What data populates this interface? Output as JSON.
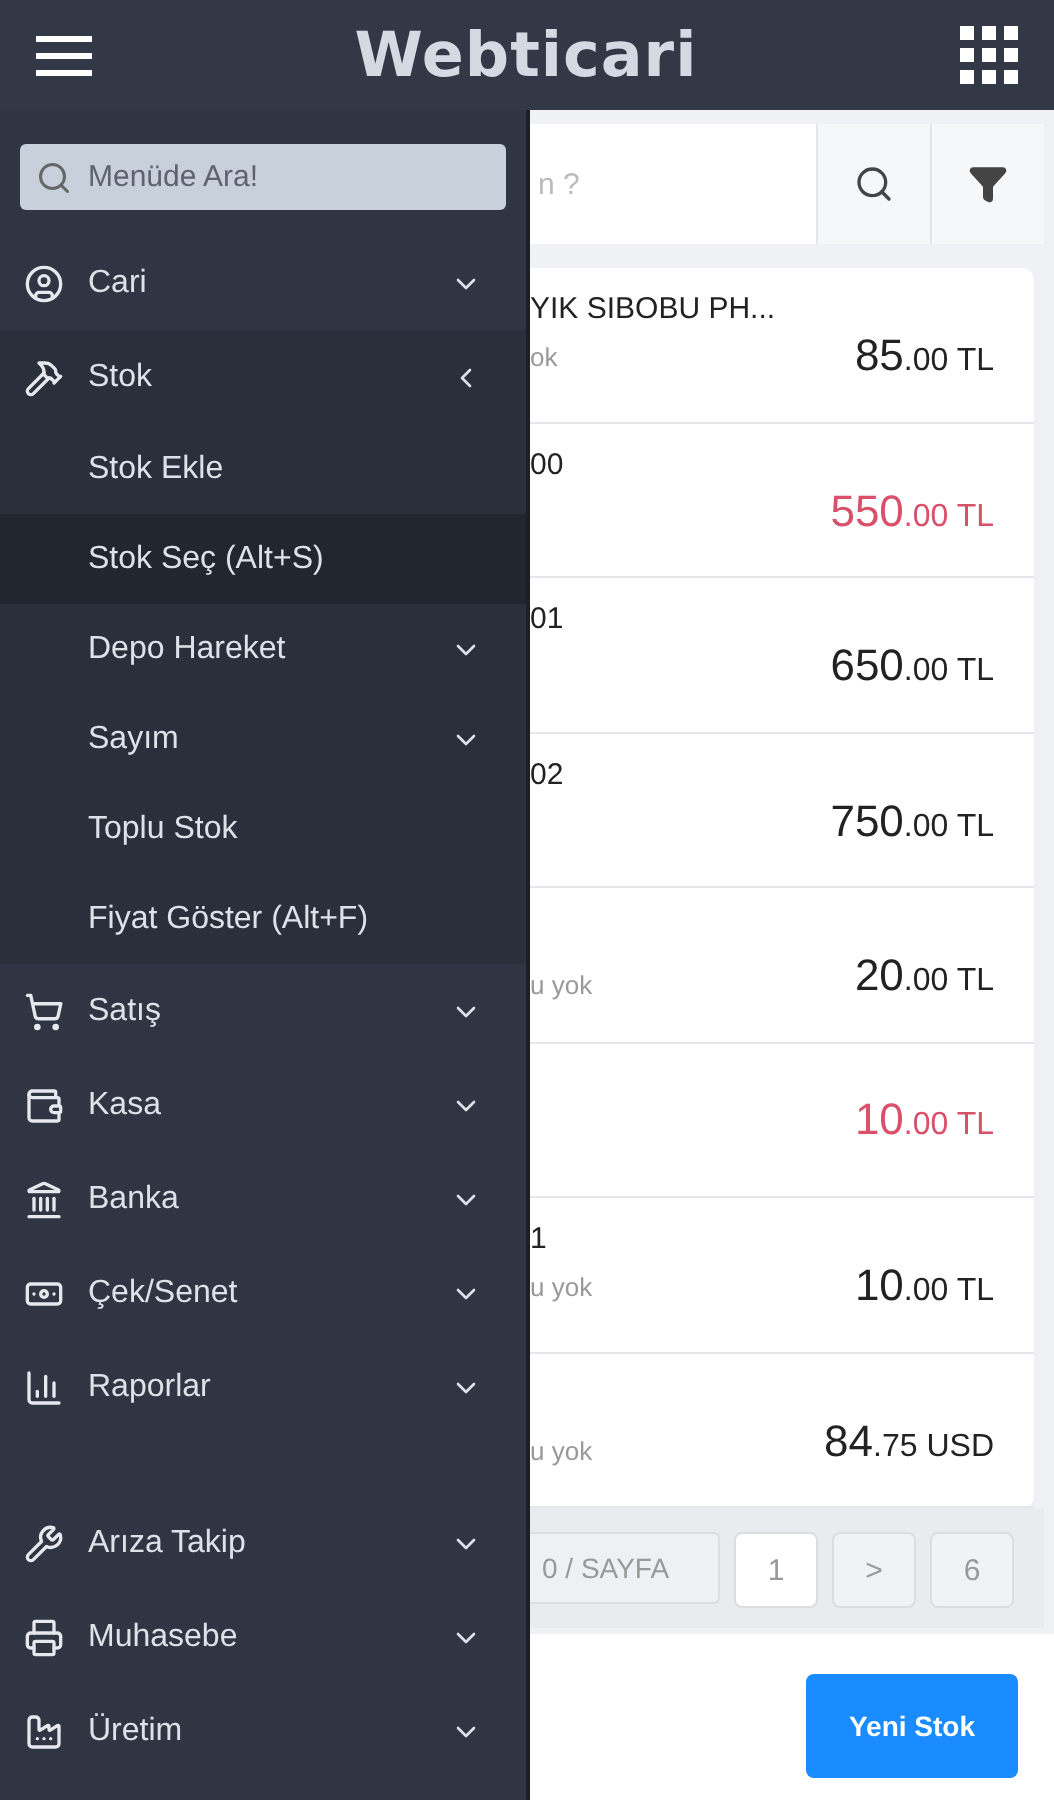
{
  "header": {
    "logo": "Webticari"
  },
  "sidebar": {
    "search": {
      "placeholder": "Menüde Ara!"
    },
    "items": [
      {
        "label": "Cari",
        "expanded": false
      },
      {
        "label": "Stok",
        "expanded": true,
        "children": [
          {
            "label": "Stok Ekle",
            "selected": false,
            "kind": "link"
          },
          {
            "label": "Stok Seç (Alt+S)",
            "selected": true,
            "kind": "link"
          },
          {
            "label": "Depo Hareket",
            "selected": false,
            "kind": "group"
          },
          {
            "label": "Sayım",
            "selected": false,
            "kind": "group"
          },
          {
            "label": "Toplu Stok",
            "selected": false,
            "kind": "link"
          },
          {
            "label": "Fiyat Göster (Alt+F)",
            "selected": false,
            "kind": "link"
          }
        ]
      },
      {
        "label": "Satış",
        "expanded": false
      },
      {
        "label": "Kasa",
        "expanded": false
      },
      {
        "label": "Banka",
        "expanded": false
      },
      {
        "label": "Çek/Senet",
        "expanded": false
      },
      {
        "label": "Raporlar",
        "expanded": false
      },
      {
        "label": "Arıza Takip",
        "expanded": false,
        "gap_before": true
      },
      {
        "label": "Muhasebe",
        "expanded": false
      },
      {
        "label": "Üretim",
        "expanded": false
      }
    ]
  },
  "search": {
    "placeholder": "n ?"
  },
  "rows": [
    {
      "title": "YIK SIBOBU PH...",
      "subtitle": "ok",
      "amount": "85",
      "decimals": ".00",
      "currency": "TL",
      "alert": false
    },
    {
      "title": "00",
      "amount": "550",
      "decimals": ".00",
      "currency": "TL",
      "alert": true
    },
    {
      "title": "01",
      "amount": "650",
      "decimals": ".00",
      "currency": "TL",
      "alert": false
    },
    {
      "title": "02",
      "amount": "750",
      "decimals": ".00",
      "currency": "TL",
      "alert": false
    },
    {
      "subtitle": "u yok",
      "amount": "20",
      "decimals": ".00",
      "currency": "TL",
      "alert": false
    },
    {
      "amount": "10",
      "decimals": ".00",
      "currency": "TL",
      "alert": true
    },
    {
      "title": "1",
      "subtitle": "u yok",
      "amount": "10",
      "decimals": ".00",
      "currency": "TL",
      "alert": false
    },
    {
      "subtitle": "u yok",
      "amount": "84",
      "decimals": ".75",
      "currency": "USD",
      "alert": false
    }
  ],
  "pagination": {
    "page_size": "0 / SAYFA",
    "pages": [
      {
        "label": "1",
        "selected": true
      },
      {
        "label": ">",
        "selected": false
      },
      {
        "label": "6",
        "selected": false
      }
    ]
  },
  "action": {
    "label": "Yeni Stok"
  }
}
